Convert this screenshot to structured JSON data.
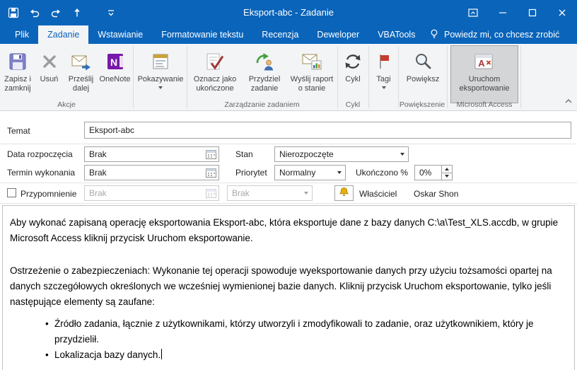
{
  "colors": {
    "titlebar": "#0a64ba",
    "ribbon-bg": "#f3f4f6",
    "selected-btn": "#d4d5d7"
  },
  "titlebar": {
    "title": "Eksport-abc - Zadanie"
  },
  "tabs": {
    "file": "Plik",
    "task": "Zadanie",
    "insert": "Wstawianie",
    "format": "Formatowanie tekstu",
    "review": "Recenzja",
    "developer": "Deweloper",
    "vbatools": "VBATools",
    "tellme": "Powiedz mi, co chcesz zrobić"
  },
  "ribbon": {
    "save_close_l1": "Zapisz i",
    "save_close_l2": "zamknij",
    "delete": "Usuń",
    "forward_l1": "Prześlij",
    "forward_l2": "dalej",
    "onenote": "OneNote",
    "show": "Pokazywanie",
    "mark_complete_l1": "Oznacz jako",
    "mark_complete_l2": "ukończone",
    "assign_l1": "Przydziel",
    "assign_l2": "zadanie",
    "report_l1": "Wyślij raport",
    "report_l2": "o stanie",
    "recurrence": "Cykl",
    "tags": "Tagi",
    "zoom": "Powiększ",
    "run_export_l1": "Uruchom",
    "run_export_l2": "eksportowanie",
    "groups": {
      "actions": "Akcje",
      "manage": "Zarządzanie zadaniem",
      "recurrence": "Cykl",
      "zoom": "Powiększenie",
      "access": "Microsoft Access"
    }
  },
  "form": {
    "subject_label": "Temat",
    "subject_value": "Eksport-abc",
    "start_label": "Data rozpoczęcia",
    "start_value": "Brak",
    "status_label": "Stan",
    "status_value": "Nierozpoczęte",
    "due_label": "Termin wykonania",
    "due_value": "Brak",
    "priority_label": "Priorytet",
    "priority_value": "Normalny",
    "complete_label": "Ukończono %",
    "complete_value": "0%",
    "reminder_label": "Przypomnienie",
    "reminder_date": "Brak",
    "reminder_time": "Brak",
    "owner_label": "Właściciel",
    "owner_value": "Oskar Shon"
  },
  "notes": {
    "p1": "Aby wykonać zapisaną operację eksportowania Eksport-abc, która eksportuje dane z bazy danych C:\\a\\Test_XLS.accdb, w grupie Microsoft Access kliknij przycisk Uruchom eksportowanie.",
    "p2": "Ostrzeżenie o zabezpieczeniach: Wykonanie tej operacji spowoduje wyeksportowanie danych przy użyciu tożsamości opartej na danych szczegółowych określonych we wcześniej wymienionej bazie danych. Kliknij przycisk Uruchom eksportowanie, tylko jeśli następujące elementy są zaufane:",
    "b1": "Źródło zadania, łącznie z użytkownikami, którzy utworzyli i zmodyfikowali to zadanie, oraz użytkownikiem, który je przydzielił.",
    "b2": "Lokalizacja bazy danych."
  }
}
